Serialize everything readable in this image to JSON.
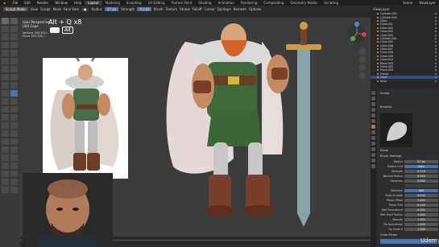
{
  "topbar": {
    "menus": [
      "File",
      "Edit",
      "Render",
      "Window",
      "Help"
    ],
    "tabs": [
      "Layout",
      "Modeling",
      "Sculpting",
      "UV Editing",
      "Texture Paint",
      "Shading",
      "Animation",
      "Rendering",
      "Compositing",
      "Geometry Nodes",
      "Scripting"
    ],
    "active_tab": "Layout",
    "scene": "Scene",
    "view_layer": "ViewLayer"
  },
  "header": {
    "mode": "Sculpt Mode",
    "menus": [
      "View",
      "Sculpt",
      "Mask",
      "Face Sets"
    ],
    "radius_label": "Radius",
    "radius_value": "47 px",
    "strength_label": "Strength",
    "strength_value": "0.118",
    "brush_label": "Brush",
    "texture_label": "Texture",
    "stroke_label": "Stroke",
    "falloff_label": "Falloff",
    "cursor_label": "Cursor",
    "options_label": "Options",
    "symmetry_label": "Dyntopo",
    "remesh_label": "Remesh"
  },
  "viewport": {
    "view_name": "User Perspective",
    "collection": "(30) Cape",
    "stats": [
      {
        "label": "Vertices",
        "value": "399,351/..."
      },
      {
        "label": "Faces",
        "value": "399,354/..."
      }
    ],
    "keycast_main": "Alt + Q x8",
    "keycast_alt": "Alt"
  },
  "outliner": {
    "title": "ViewLayer",
    "items": [
      "Cylinder.004",
      "Cylinder.005",
      "Cube",
      "Cube.001",
      "Cube.002",
      "Cube.003",
      "Cube.004",
      "Cylinder.001",
      "Cube.005",
      "Cube.006",
      "Cube.007",
      "Cube.008",
      "Cube.009",
      "Cube.010",
      "Plane.001",
      "Plane.002",
      "Plane.003",
      "Sword",
      "Cape",
      "Body"
    ]
  },
  "properties": {
    "panel_name": "Sculpt",
    "brush_section": "Brushes",
    "brush_name": "Draw",
    "settings_section": "Brush Settings",
    "rows": [
      {
        "label": "Radius",
        "value": "47 px"
      },
      {
        "label": "Radius Unit",
        "value": "View"
      },
      {
        "label": "Strength",
        "value": "0.118"
      },
      {
        "label": "Normal Radius",
        "value": "0.500"
      },
      {
        "label": "Hardness",
        "value": "0.000"
      },
      {
        "label": "",
        "value": ""
      },
      {
        "label": "Direction",
        "value": "Add"
      },
      {
        "label": "Auto-Smooth",
        "value": "0.000"
      },
      {
        "label": "Plane Offset",
        "value": "0.000"
      },
      {
        "label": "Plane Trim",
        "value": "0.500"
      },
      {
        "label": "Wet Persistence",
        "value": "0.000"
      },
      {
        "label": "Wet Paint Radius",
        "value": "1.000"
      },
      {
        "label": "Density",
        "value": "1.000"
      },
      {
        "label": "Tip Roundness",
        "value": "1.000"
      },
      {
        "label": "Tip Scale X",
        "value": "1.000"
      }
    ],
    "color_section": "Color Picker"
  },
  "watermark": "Udemy",
  "colors": {
    "accent": "#4772b3",
    "panel_bg": "#2b2b2b",
    "viewport_bg": "#3c3c3c",
    "selection": "#334d80",
    "object_icon": "#e59b38"
  }
}
